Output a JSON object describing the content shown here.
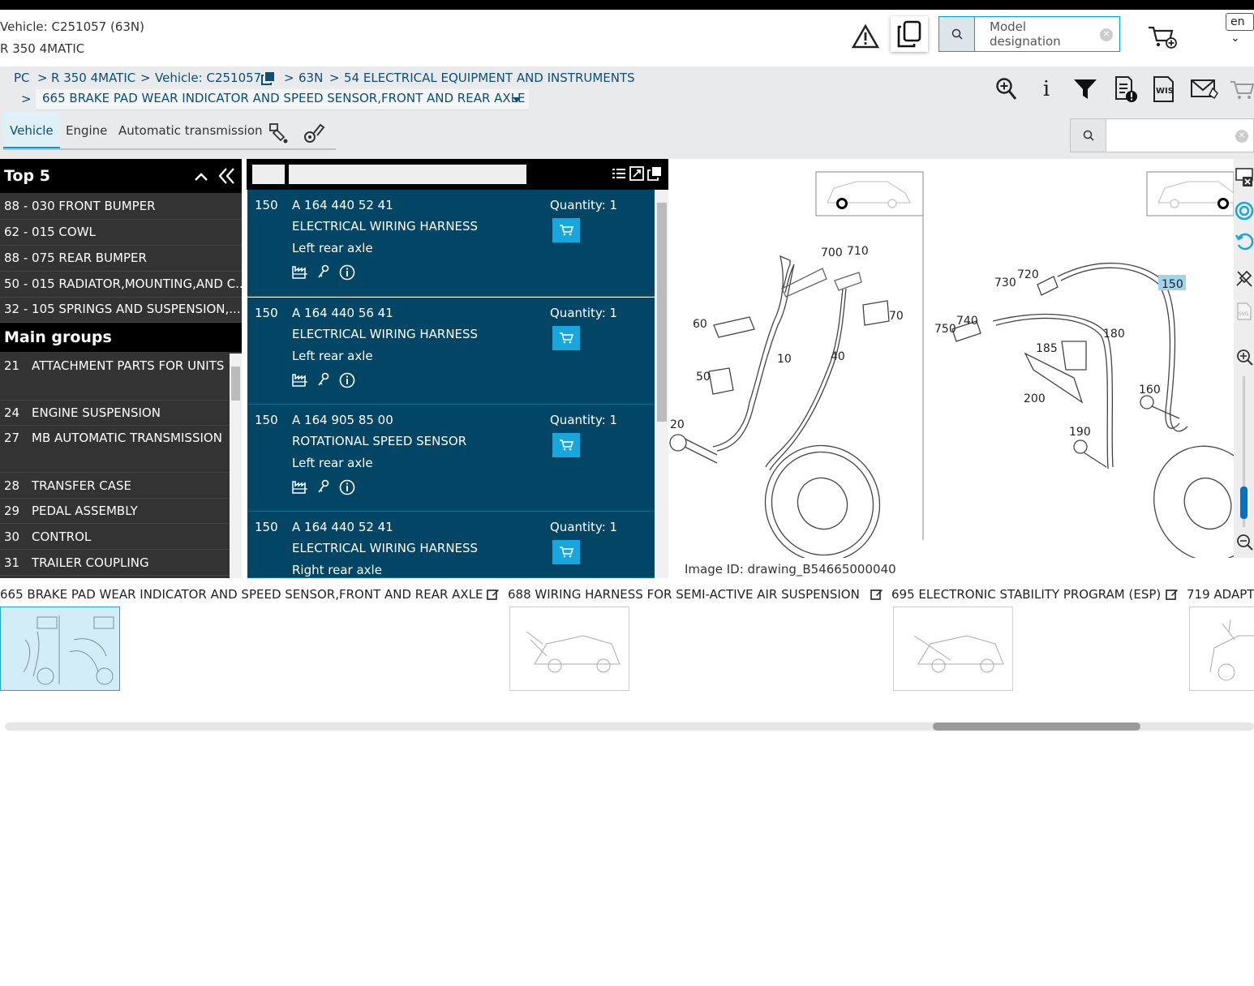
{
  "header": {
    "vehicle_line1": "Vehicle: C251057 (63N)",
    "vehicle_line2": "R 350 4MATIC",
    "search_placeholder": "Model designation",
    "language": "en"
  },
  "breadcrumb": {
    "items": [
      "PC",
      "R 350 4MATIC",
      "Vehicle: C251057",
      "63N",
      "54 ELECTRICAL EQUIPMENT AND INSTRUMENTS"
    ],
    "separator": ">",
    "current": "665 BRAKE PAD WEAR INDICATOR AND SPEED SENSOR,FRONT AND REAR AXLE"
  },
  "tabs": [
    "Vehicle",
    "Engine",
    "Automatic transmission"
  ],
  "left": {
    "top5_title": "Top 5",
    "top5": [
      "88 - 030 FRONT BUMPER",
      "62 - 015 COWL",
      "88 - 075 REAR BUMPER",
      "50 - 015 RADIATOR,MOUNTING,AND C...",
      "32 - 105 SPRINGS AND SUSPENSION,..."
    ],
    "main_title": "Main groups",
    "groups": [
      {
        "n": "21",
        "t": "ATTACHMENT PARTS FOR UNITS"
      },
      {
        "n": "24",
        "t": "ENGINE SUSPENSION"
      },
      {
        "n": "27",
        "t": "MB AUTOMATIC TRANSMISSION"
      },
      {
        "n": "28",
        "t": "TRANSFER CASE"
      },
      {
        "n": "29",
        "t": "PEDAL ASSEMBLY"
      },
      {
        "n": "30",
        "t": "CONTROL"
      },
      {
        "n": "31",
        "t": "TRAILER COUPLING"
      }
    ]
  },
  "parts": [
    {
      "pos": "150",
      "number": "A 164 440 52 41",
      "name": "ELECTRICAL WIRING HARNESS",
      "axle": "Left rear axle",
      "qty": "Quantity: 1"
    },
    {
      "pos": "150",
      "number": "A 164 440 56 41",
      "name": "ELECTRICAL WIRING HARNESS",
      "axle": "Left rear axle",
      "qty": "Quantity: 1"
    },
    {
      "pos": "150",
      "number": "A 164 905 85 00",
      "name": "ROTATIONAL SPEED SENSOR",
      "axle": "Left rear axle",
      "qty": "Quantity: 1"
    },
    {
      "pos": "150",
      "number": "A 164 440 52 41",
      "name": "ELECTRICAL WIRING HARNESS",
      "axle": "Right rear axle",
      "qty": "Quantity: 1"
    }
  ],
  "drawing": {
    "image_id": "Image ID: drawing_B54665000040",
    "callouts_left": [
      "700",
      "710",
      "60",
      "70",
      "10",
      "40",
      "50",
      "20"
    ],
    "callouts_right": [
      "730",
      "720",
      "150",
      "750",
      "740",
      "180",
      "185",
      "200",
      "160",
      "190"
    ],
    "highlight": "150"
  },
  "thumbnails": [
    "665 BRAKE PAD WEAR INDICATOR AND SPEED SENSOR,FRONT AND REAR AXLE",
    "688 WIRING HARNESS FOR SEMI-ACTIVE AIR SUSPENSION",
    "695 ELECTRONIC STABILITY PROGRAM (ESP)",
    "719 ADAPT"
  ],
  "colors": {
    "accent": "#00a0e0",
    "part_bg": "#034565",
    "cart": "#17a7dd",
    "highlight": "#9fd3ee"
  }
}
